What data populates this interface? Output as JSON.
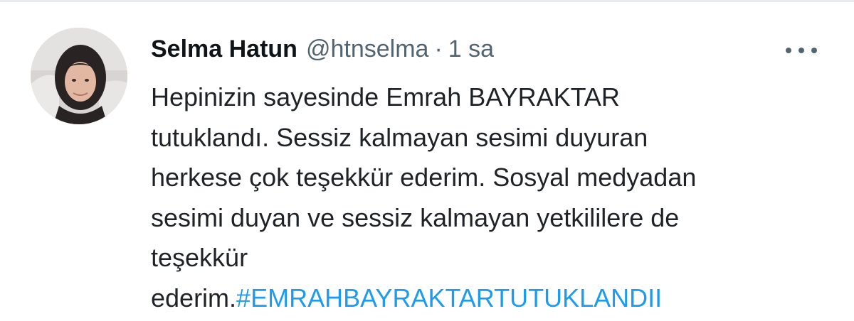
{
  "tweet": {
    "author_name": "Selma Hatun",
    "handle": "@htnselma",
    "separator": "·",
    "time": "1 sa",
    "more_icon": "more-horizontal-icon",
    "avatar_icon": "profile-avatar",
    "text_lines": [
      "Hepinizin sayesinde Emrah BAYRAKTAR",
      "tutuklandı. Sessiz kalmayan sesimi duyuran",
      "herkese çok teşekkür ederim. Sosyal medyadan",
      "sesimi duyan ve sessiz kalmayan yetkililere de",
      "teşekkür",
      "ederim."
    ],
    "hashtag": "#EMRAHBAYRAKTARTUTUKLANDII",
    "hashtag_color": "#1d9bf0"
  }
}
